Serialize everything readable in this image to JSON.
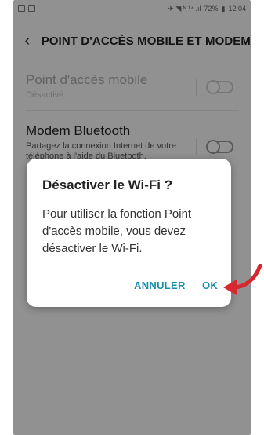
{
  "status_bar": {
    "indicators": "✈ ◥ ᴺ ¹⁴ .ıl",
    "battery": "72%",
    "time": "12:04"
  },
  "header": {
    "title": "POINT D'ACCÈS MOBILE ET MODEM",
    "back_icon": "chevron-left-icon"
  },
  "settings": [
    {
      "title": "Point d'accès mobile",
      "subtitle": "Désactivé",
      "enabled": false
    },
    {
      "title": "Modem Bluetooth",
      "subtitle": "Partagez la connexion Internet de votre téléphone à l'aide du Bluetooth.",
      "enabled": false
    }
  ],
  "dialog": {
    "title": "Désactiver le Wi-Fi ?",
    "message": "Pour utiliser la fonction Point d'accès mobile, vous devez désactiver le Wi-Fi.",
    "cancel_label": "ANNULER",
    "ok_label": "OK"
  },
  "colors": {
    "accent": "#1a8ea8",
    "arrow": "#d7282f"
  }
}
